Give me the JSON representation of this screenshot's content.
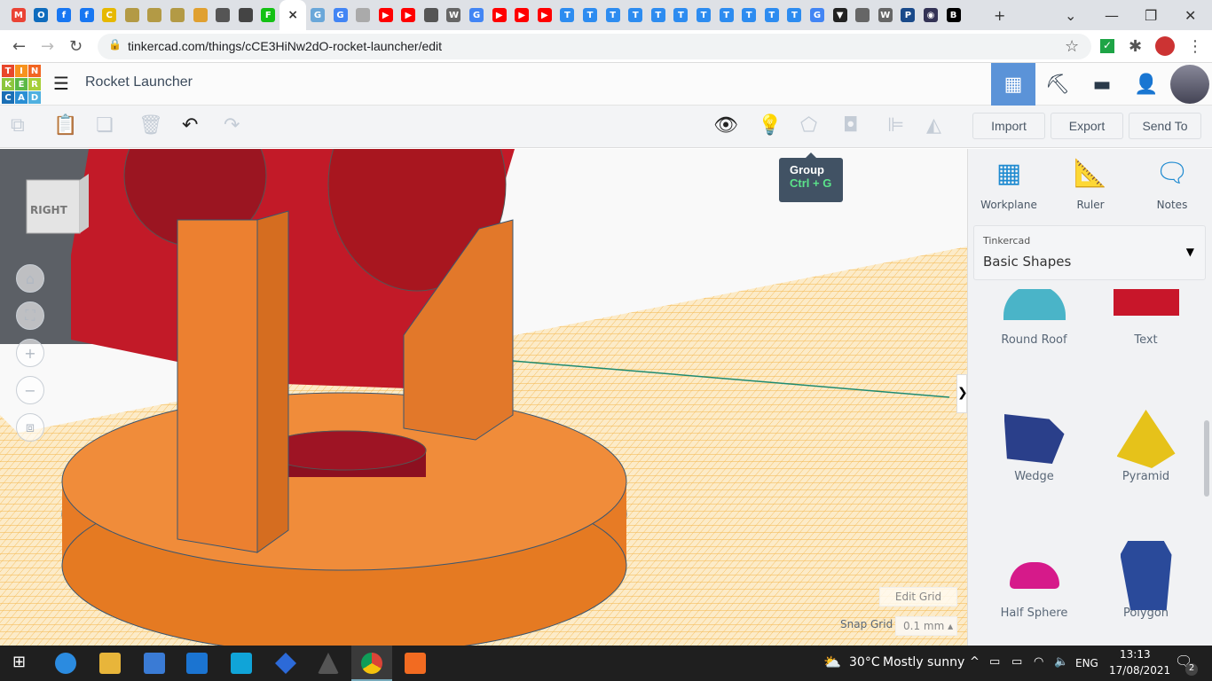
{
  "browser": {
    "tabs": [
      {
        "icon": "gmail-icon",
        "glyph": "M",
        "color": "#ea4335"
      },
      {
        "icon": "outlook-icon",
        "glyph": "O",
        "color": "#0f6cbd"
      },
      {
        "icon": "facebook-icon",
        "glyph": "f",
        "color": "#1877f2"
      },
      {
        "icon": "facebook-icon",
        "glyph": "f",
        "color": "#1877f2"
      },
      {
        "icon": "c-icon",
        "glyph": "C",
        "color": "#e6b800"
      },
      {
        "icon": "mascot-icon",
        "glyph": "",
        "color": "#b39a45"
      },
      {
        "icon": "mascot-icon",
        "glyph": "",
        "color": "#b39a45"
      },
      {
        "icon": "mascot-icon",
        "glyph": "",
        "color": "#b39a45"
      },
      {
        "icon": "avatar-icon",
        "glyph": "",
        "color": "#e0a030"
      },
      {
        "icon": "globe-icon",
        "glyph": "",
        "color": "#555"
      },
      {
        "icon": "feather-icon",
        "glyph": "",
        "color": "#444"
      },
      {
        "icon": "f-green-icon",
        "glyph": "F",
        "color": "#14c114"
      },
      {
        "icon": "close-icon",
        "glyph": "×",
        "color": "",
        "active": true
      },
      {
        "icon": "gt-icon",
        "glyph": "G",
        "color": "#6aa7d9"
      },
      {
        "icon": "google-icon",
        "glyph": "G",
        "color": "#4285f4"
      },
      {
        "icon": "page-icon",
        "glyph": "",
        "color": "#aaa"
      },
      {
        "icon": "youtube-icon",
        "glyph": "▶",
        "color": "#f00"
      },
      {
        "icon": "youtube-icon",
        "glyph": "▶",
        "color": "#f00"
      },
      {
        "icon": "globe-icon",
        "glyph": "",
        "color": "#555"
      },
      {
        "icon": "wikipedia-icon",
        "glyph": "W",
        "color": "#666"
      },
      {
        "icon": "google-icon",
        "glyph": "G",
        "color": "#4285f4"
      },
      {
        "icon": "youtube-icon",
        "glyph": "▶",
        "color": "#f00"
      },
      {
        "icon": "youtube-icon",
        "glyph": "▶",
        "color": "#f00"
      },
      {
        "icon": "youtube-icon",
        "glyph": "▶",
        "color": "#f00"
      },
      {
        "icon": "t-icon",
        "glyph": "T",
        "color": "#2d8cf0"
      },
      {
        "icon": "t-icon",
        "glyph": "T",
        "color": "#2d8cf0"
      },
      {
        "icon": "t-icon",
        "glyph": "T",
        "color": "#2d8cf0"
      },
      {
        "icon": "t-icon",
        "glyph": "T",
        "color": "#2d8cf0"
      },
      {
        "icon": "t-icon",
        "glyph": "T",
        "color": "#2d8cf0"
      },
      {
        "icon": "t-icon",
        "glyph": "T",
        "color": "#2d8cf0"
      },
      {
        "icon": "t-icon",
        "glyph": "T",
        "color": "#2d8cf0"
      },
      {
        "icon": "t-icon",
        "glyph": "T",
        "color": "#2d8cf0"
      },
      {
        "icon": "t-icon",
        "glyph": "T",
        "color": "#2d8cf0"
      },
      {
        "icon": "t-icon",
        "glyph": "T",
        "color": "#2d8cf0"
      },
      {
        "icon": "t-icon",
        "glyph": "T",
        "color": "#2d8cf0"
      },
      {
        "icon": "google-icon",
        "glyph": "G",
        "color": "#4285f4"
      },
      {
        "icon": "shield-icon",
        "glyph": "▼",
        "color": "#222"
      },
      {
        "icon": "chrome-icon",
        "glyph": "",
        "color": "#666"
      },
      {
        "icon": "wikipedia-icon",
        "glyph": "W",
        "color": "#666"
      },
      {
        "icon": "p21-icon",
        "glyph": "P",
        "color": "#1a4a8a"
      },
      {
        "icon": "eye-icon",
        "glyph": "◉",
        "color": "#335"
      },
      {
        "icon": "bbc-icon",
        "glyph": "B",
        "color": "#000"
      }
    ],
    "new_tab": "+",
    "url": "tinkercad.com/things/cCE3HiNw2dO-rocket-launcher/edit"
  },
  "app": {
    "logo_letters": [
      "T",
      "I",
      "N",
      "K",
      "E",
      "R",
      "C",
      "A",
      "D"
    ],
    "logo_colors": [
      "#e8472b",
      "#f7931e",
      "#f26522",
      "#8dc63f",
      "#5bb946",
      "#a6ce39",
      "#1a6fb5",
      "#2a8fd4",
      "#4fb0e0"
    ],
    "title": "Rocket Launcher",
    "accent": "#5b93d8"
  },
  "toolbar": {
    "import": "Import",
    "export": "Export",
    "send_to": "Send To"
  },
  "tooltip": {
    "title": "Group",
    "shortcut": "Ctrl + G"
  },
  "side": {
    "tools": [
      {
        "label": "Workplane",
        "icon": "workplane-icon"
      },
      {
        "label": "Ruler",
        "icon": "ruler-icon"
      },
      {
        "label": "Notes",
        "icon": "notes-icon"
      }
    ],
    "library_label": "Tinkercad",
    "library_value": "Basic Shapes",
    "shapes": [
      {
        "label": "Round Roof"
      },
      {
        "label": "Text"
      },
      {
        "label": "Wedge"
      },
      {
        "label": "Pyramid"
      },
      {
        "label": "Half Sphere"
      },
      {
        "label": "Polygon"
      }
    ]
  },
  "canvas": {
    "view_cube_label": "RIGHT",
    "edit_grid": "Edit Grid",
    "snap_grid_label": "Snap Grid",
    "snap_grid_value": "0.1 mm"
  },
  "taskbar": {
    "temp": "30°C",
    "weather": "Mostly sunny",
    "lang": "ENG",
    "time": "13:13",
    "date": "17/08/2021",
    "notifications": "2"
  }
}
